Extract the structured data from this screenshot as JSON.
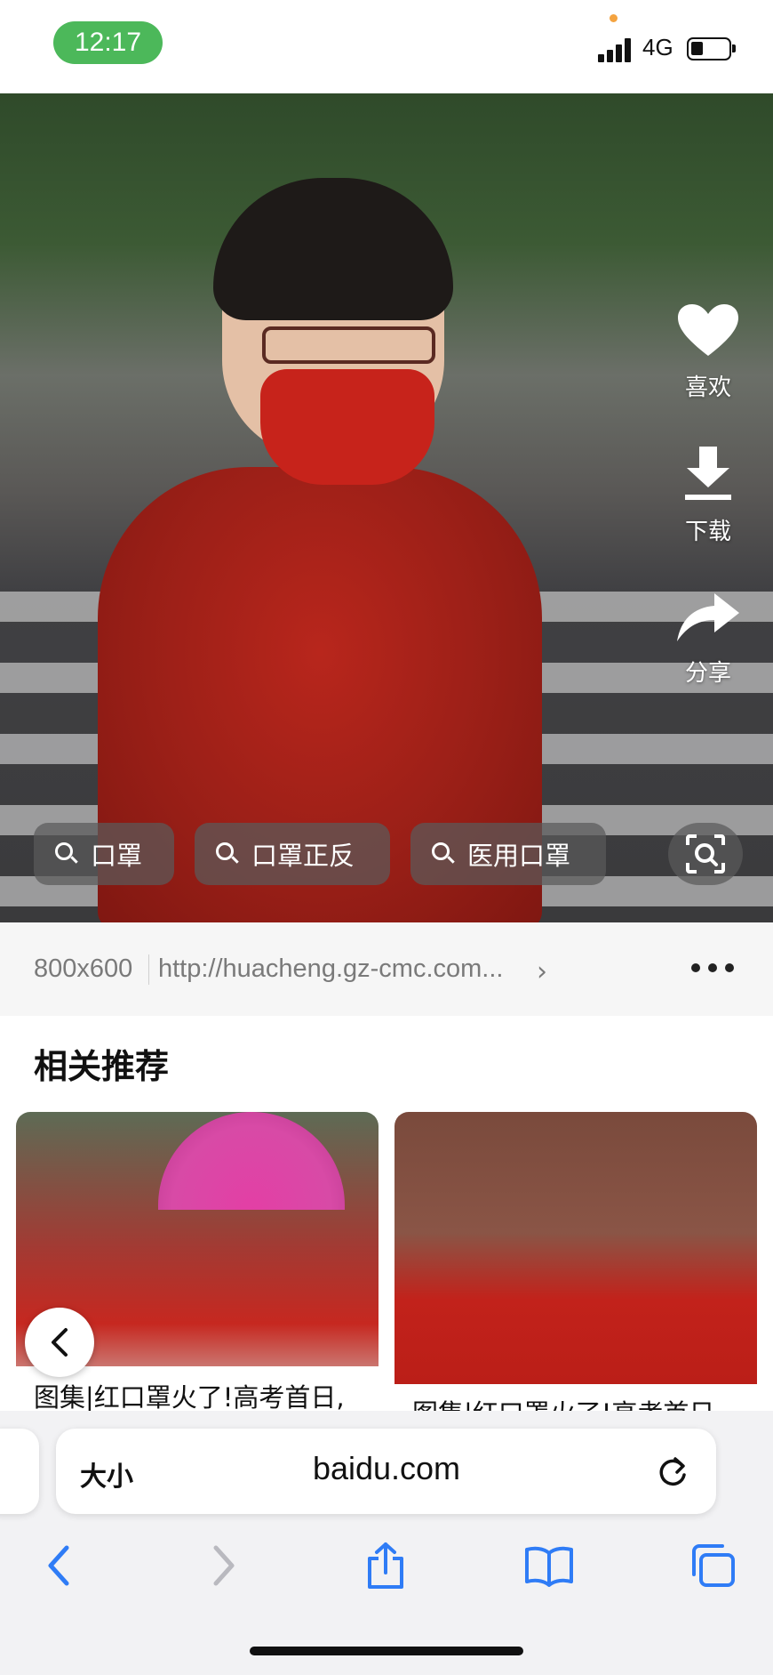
{
  "status_bar": {
    "time": "12:17",
    "network": "4G",
    "battery_level": 0.25,
    "signal_bars": 4
  },
  "photo": {
    "search_chips": [
      "口罩",
      "口罩正反",
      "医用口罩"
    ],
    "actions": {
      "like_label": "喜欢",
      "download_label": "下载",
      "share_label": "分享"
    }
  },
  "image_info": {
    "size": "800x600",
    "source_url": "http://huacheng.gz-cmc.com..."
  },
  "related": {
    "title": "相关推荐",
    "items": [
      {
        "caption": "图集|红口罩火了!高考首日,"
      },
      {
        "caption": "图集|红口罩火了!高考首日"
      }
    ]
  },
  "browser": {
    "text_size_label": "大小",
    "domain": "baidu.com",
    "accent_color": "#2f7cf6"
  }
}
